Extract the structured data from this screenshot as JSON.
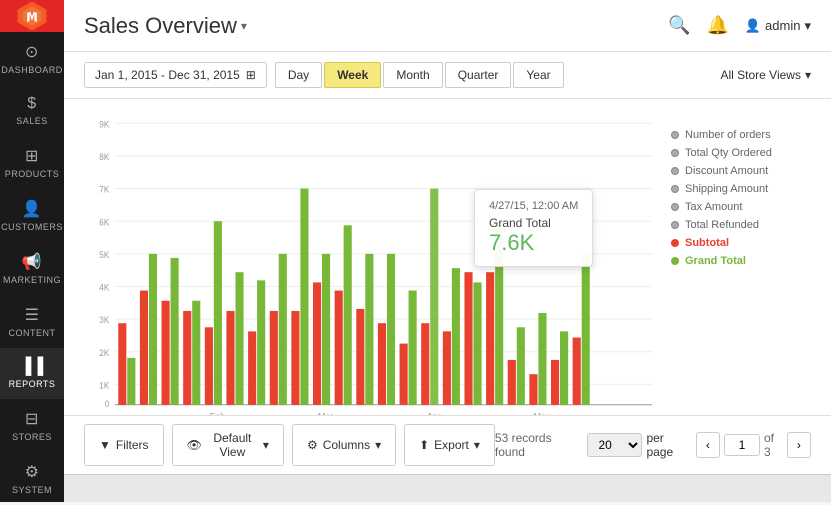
{
  "sidebar": {
    "logo_alt": "Magento",
    "items": [
      {
        "id": "dashboard",
        "label": "DASHBOARD",
        "icon": "⊙"
      },
      {
        "id": "sales",
        "label": "SALES",
        "icon": "$"
      },
      {
        "id": "products",
        "label": "PRODUCTS",
        "icon": "⊞"
      },
      {
        "id": "customers",
        "label": "CUSTOMERS",
        "icon": "👤"
      },
      {
        "id": "marketing",
        "label": "MARKETING",
        "icon": "📢"
      },
      {
        "id": "content",
        "label": "CONTENT",
        "icon": "☰"
      },
      {
        "id": "reports",
        "label": "REPORTS",
        "icon": "▐▐",
        "active": true
      },
      {
        "id": "stores",
        "label": "STORES",
        "icon": "⊟"
      },
      {
        "id": "system",
        "label": "SYSTEM",
        "icon": "⚙"
      }
    ]
  },
  "header": {
    "title": "Sales Overview",
    "dropdown_icon": "▾",
    "search_icon": "🔍",
    "bell_icon": "🔔",
    "admin_label": "admin",
    "admin_dropdown": "▾"
  },
  "toolbar": {
    "date_range": "Jan 1, 2015 - Dec 31, 2015",
    "calendar_icon": "⊞",
    "periods": [
      {
        "label": "Day",
        "active": false
      },
      {
        "label": "Week",
        "active": true
      },
      {
        "label": "Month",
        "active": false
      },
      {
        "label": "Quarter",
        "active": false
      },
      {
        "label": "Year",
        "active": false
      }
    ],
    "store_view": "All Store Views",
    "store_dropdown": "▾"
  },
  "chart": {
    "y_labels": [
      "9K",
      "8K",
      "7K",
      "6K",
      "5K",
      "4K",
      "3K",
      "2K",
      "1K",
      "0"
    ],
    "x_labels": [
      "Feb",
      "Mar",
      "Apr",
      "May"
    ],
    "tooltip": {
      "date": "4/27/15, 12:00 AM",
      "label": "Grand Total",
      "value": "7.6K"
    },
    "legend": [
      {
        "label": "Number of orders",
        "type": "gray"
      },
      {
        "label": "Total Qty Ordered",
        "type": "gray"
      },
      {
        "label": "Discount Amount",
        "type": "gray"
      },
      {
        "label": "Shipping Amount",
        "type": "gray"
      },
      {
        "label": "Tax Amount",
        "type": "gray"
      },
      {
        "label": "Total Refunded",
        "type": "gray"
      },
      {
        "label": "Subtotal",
        "type": "red"
      },
      {
        "label": "Grand Total",
        "type": "green"
      }
    ]
  },
  "bottom_bar": {
    "filters_label": "Filters",
    "default_view_label": "Default View",
    "columns_label": "Columns",
    "export_label": "Export",
    "records_found": "53 records found",
    "per_page_value": "20",
    "per_page_label": "per page",
    "current_page": "1",
    "total_pages": "of 3"
  },
  "colors": {
    "red": "#e8422e",
    "green": "#78b839",
    "active_tab": "#f5e87e",
    "sidebar_bg": "#1a1a1a",
    "header_bg": "#fff"
  }
}
